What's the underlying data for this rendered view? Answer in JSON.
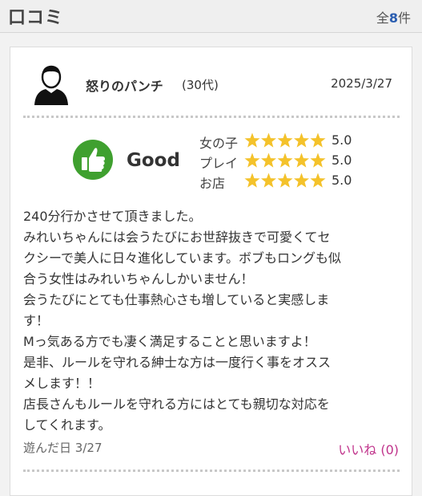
{
  "header": {
    "title": "口コミ",
    "count_prefix": "全",
    "count": "8",
    "count_suffix": "件"
  },
  "review": {
    "reviewer_name": "怒りのパンチ",
    "reviewer_age": "(30代)",
    "date": "2025/3/27",
    "verdict": "Good",
    "ratings": [
      {
        "label": "女の子",
        "stars": 5,
        "score": "5.0"
      },
      {
        "label": "プレイ",
        "stars": 5,
        "score": "5.0"
      },
      {
        "label": "お店",
        "stars": 5,
        "score": "5.0"
      }
    ],
    "body": [
      "240分行かさせて頂きました。",
      "みれいちゃんには会うたびにお世辞抜きで可愛くてセ",
      "クシーで美人に日々進化しています。ボブもロングも似",
      "合う女性はみれいちゃんしかいません！",
      "会うたびにとても仕事熱心さも増していると実感しま",
      "す！",
      "Mっ気ある方でも凄く満足することと思いますよ！",
      "是非、ルールを守れる紳士な方は一度行く事をオスス",
      "メします！！",
      "店長さんもルールを守れる方にはとても親切な対応を",
      "してくれます。"
    ],
    "visited_label": "遊んだ日",
    "visited_date": "3/27",
    "like_label": "いいね",
    "like_count": "(0)"
  },
  "colors": {
    "accent_blue": "#2a5db0",
    "star_yellow": "#f4c22b",
    "good_green": "#3fa02f",
    "like_pink": "#c0338b"
  },
  "icons": [
    "user-avatar-icon",
    "thumbs-up-icon",
    "star-icon"
  ]
}
